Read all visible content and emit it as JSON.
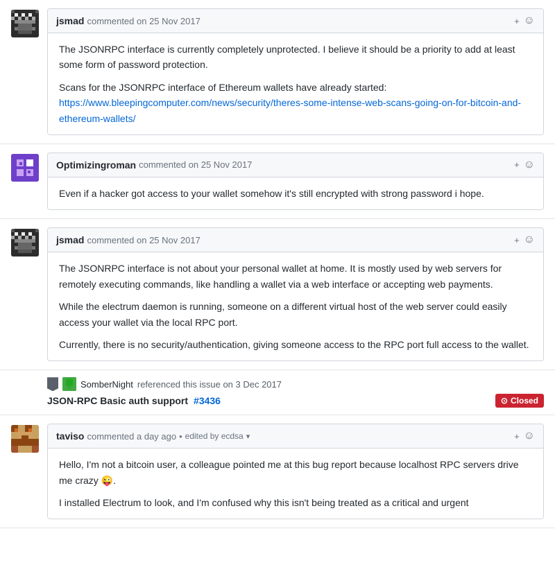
{
  "comments": [
    {
      "id": "comment-1",
      "author": "jsmad",
      "meta": "commented on 25 Nov 2017",
      "body_paragraphs": [
        "The JSONRPC interface is currently completely unprotected. I believe it should be a priority to add at least some form of password protection.",
        "Scans for the JSONRPC interface of Ethereum wallets have already started:"
      ],
      "link": {
        "text": "https://www.bleepingcomputer.com/news/security/theres-some-intense-web-scans-going-on-for-bitcoin-and-ethereum-wallets/",
        "href": "#"
      },
      "avatar_type": "jsmad"
    },
    {
      "id": "comment-2",
      "author": "Optimizingroman",
      "meta": "commented on 25 Nov 2017",
      "body_paragraphs": [
        "Even if a hacker got access to your wallet somehow it's still encrypted with strong password i hope."
      ],
      "link": null,
      "avatar_type": "optimizing"
    },
    {
      "id": "comment-3",
      "author": "jsmad",
      "meta": "commented on 25 Nov 2017",
      "body_paragraphs": [
        "The JSONRPC interface is not about your personal wallet at home. It is mostly used by web servers for remotely executing commands, like handling a wallet via a web interface or accepting web payments.",
        "While the electrum daemon is running, someone on a different virtual host of the web server could easily access your wallet via the local RPC port.",
        "Currently, there is no security/authentication, giving someone access to the RPC port full access to the wallet."
      ],
      "link": null,
      "avatar_type": "jsmad"
    }
  ],
  "reference": {
    "bookmark_label": "bookmark",
    "ref_avatar_label": "SomberNight-avatar",
    "ref_username": "SomberNight",
    "ref_text": "referenced this issue on 3 Dec 2017",
    "issue_title": "JSON-RPC Basic auth support",
    "issue_number": "#3436",
    "status": "Closed",
    "status_icon": "⊙"
  },
  "last_comment": {
    "id": "comment-4",
    "author": "taviso",
    "meta": "commented a day ago",
    "edited_text": "edited by ecdsa",
    "body_paragraphs": [
      "Hello, I'm not a bitcoin user, a colleague pointed me at this bug report because localhost RPC servers drive me crazy 😜.",
      "I installed Electrum to look, and I'm confused why this isn't being treated as a critical and urgent"
    ],
    "avatar_type": "taviso"
  },
  "icons": {
    "plus": "+",
    "smiley": "☺",
    "closed_circle": "⊙",
    "dropdown_arrow": "▾"
  }
}
